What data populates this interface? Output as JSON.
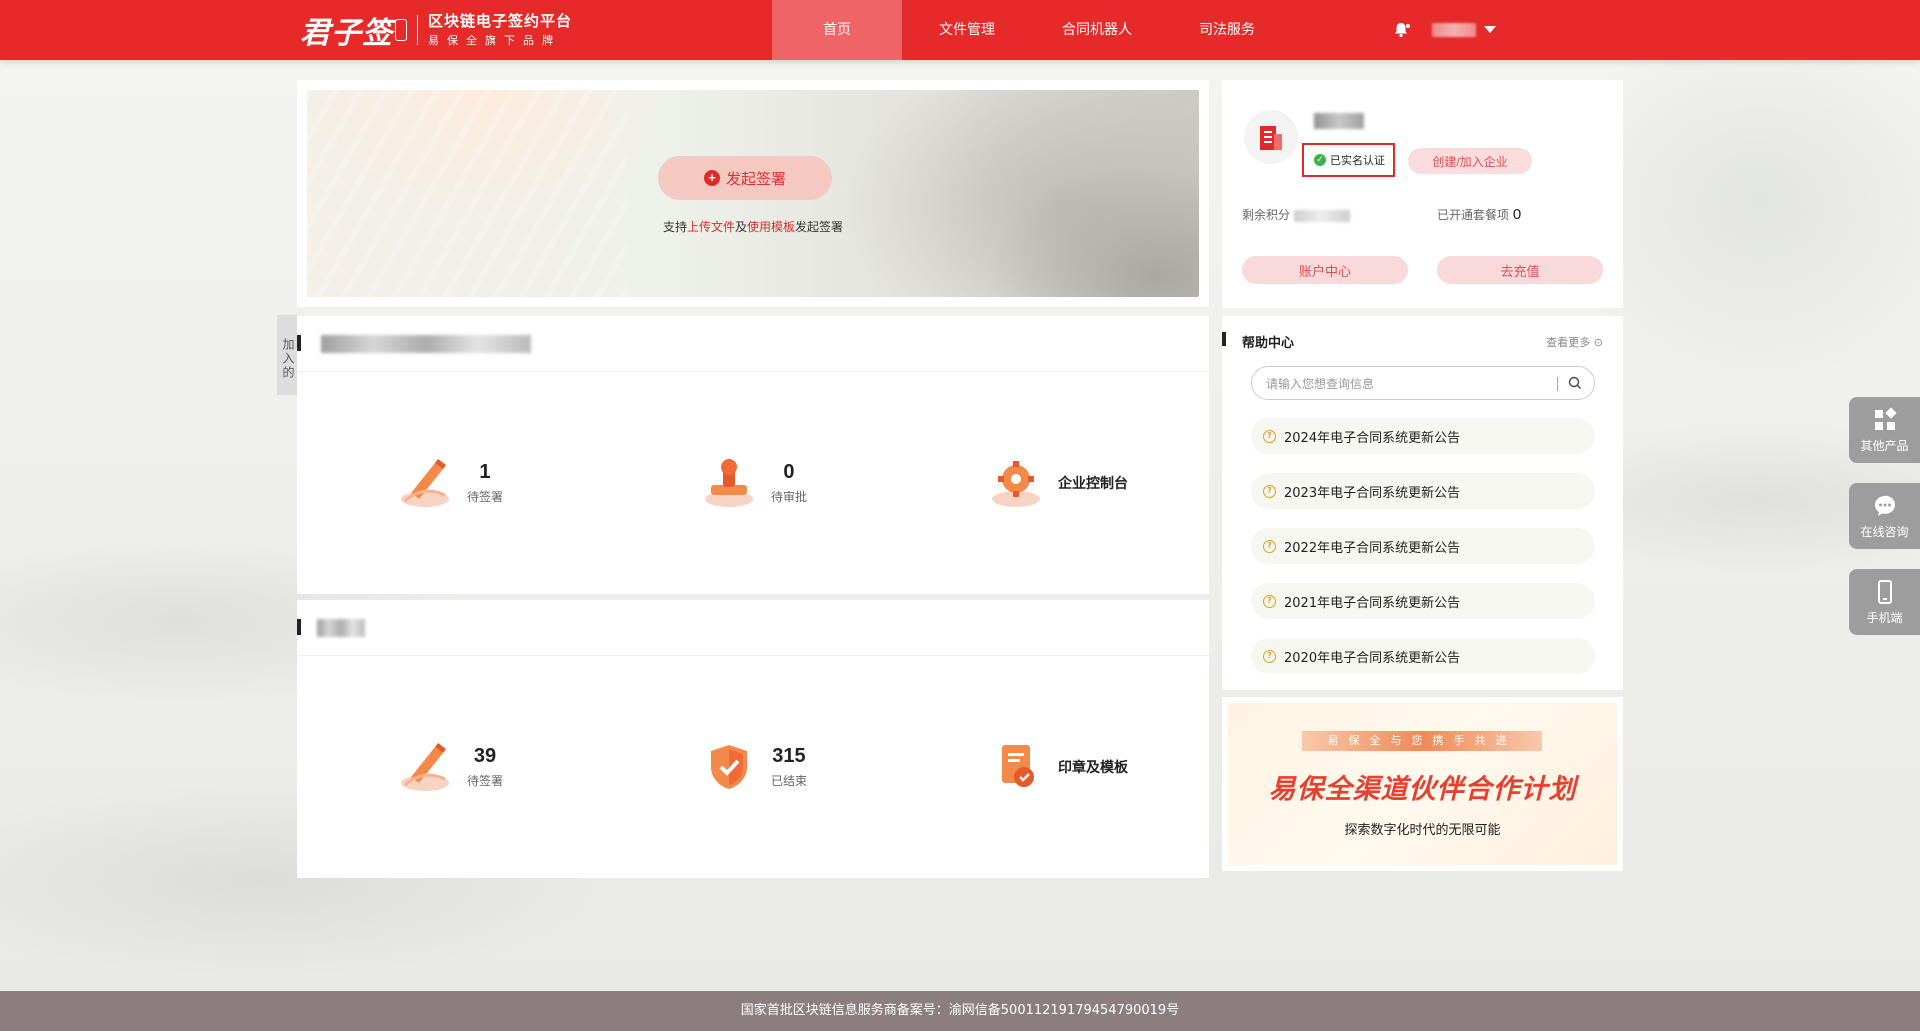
{
  "brand": {
    "logo_text": "君子签",
    "subtitle_1": "区块链电子签约平台",
    "subtitle_2": "易保全旗下品牌"
  },
  "nav": {
    "items": [
      {
        "label": "首页",
        "active": true
      },
      {
        "label": "文件管理",
        "active": false
      },
      {
        "label": "合同机器人",
        "active": false
      },
      {
        "label": "司法服务",
        "active": false
      }
    ]
  },
  "banner": {
    "start_button": "发起签署",
    "hint_prefix": "支持",
    "hint_link1": "上传文件",
    "hint_mid": "及",
    "hint_link2": "使用模板",
    "hint_suffix": "发起签署"
  },
  "side_tab": "加入的",
  "section_company": {
    "stats": [
      {
        "value": "1",
        "label": "待签署",
        "icon": "pen-icon"
      },
      {
        "value": "0",
        "label": "待审批",
        "icon": "stamp-icon"
      },
      {
        "value": "",
        "label": "企业控制台",
        "icon": "gear-icon"
      }
    ]
  },
  "section_personal": {
    "stats": [
      {
        "value": "39",
        "label": "待签署",
        "icon": "pen-icon"
      },
      {
        "value": "315",
        "label": "已结束",
        "icon": "shield-check-icon"
      },
      {
        "value": "",
        "label": "印章及模板",
        "icon": "seal-template-icon"
      }
    ]
  },
  "profile": {
    "verified_label": "已实名认证",
    "join_button": "创建/加入企业",
    "points_label": "剩余积分",
    "package_label": "已开通套餐项",
    "package_count": "0",
    "account_button": "账户中心",
    "recharge_button": "去充值"
  },
  "help": {
    "title": "帮助中心",
    "more": "查看更多",
    "search_placeholder": "请输入您想查询信息",
    "items": [
      "2024年电子合同系统更新公告",
      "2023年电子合同系统更新公告",
      "2022年电子合同系统更新公告",
      "2021年电子合同系统更新公告",
      "2020年电子合同系统更新公告"
    ]
  },
  "promo": {
    "tag": "易保全与您携手共进",
    "title": "易保全渠道伙伴合作计划",
    "subtitle": "探索数字化时代的无限可能"
  },
  "float_buttons": [
    {
      "label": "其他产品",
      "icon": "grid-icon"
    },
    {
      "label": "在线咨询",
      "icon": "chat-icon"
    },
    {
      "label": "手机端",
      "icon": "phone-icon"
    }
  ],
  "footer": {
    "text": "国家首批区块链信息服务商备案号：渝网信备50011219179454790019号"
  },
  "colors": {
    "brand_red": "#e62a2a",
    "nav_active": "#ef6464",
    "footer": "#8c7e7e"
  }
}
